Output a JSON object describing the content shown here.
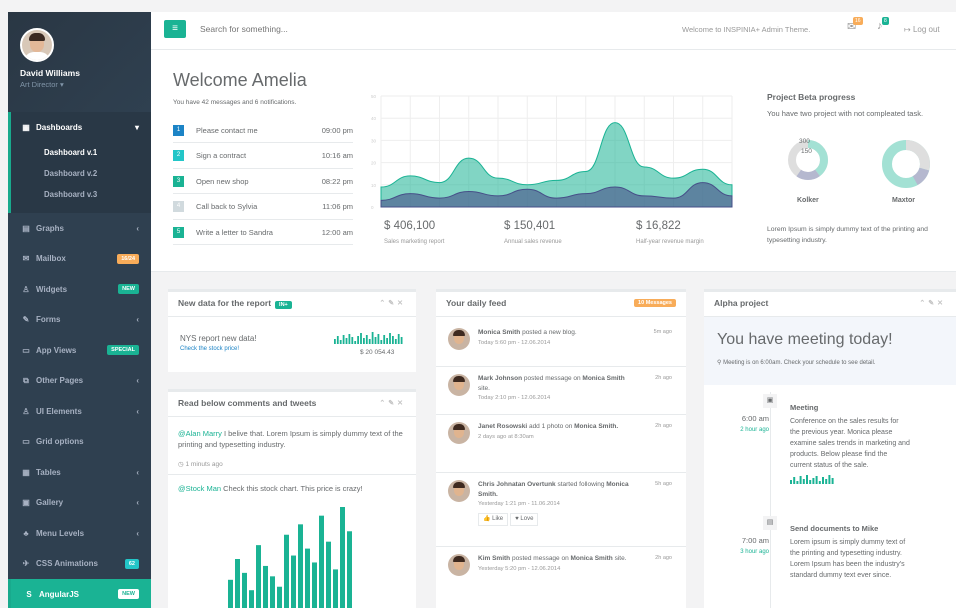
{
  "profile": {
    "name": "David Williams",
    "role": "Art Director ▾"
  },
  "nav": {
    "dashboards": "Dashboards",
    "sub": [
      "Dashboard v.1",
      "Dashboard v.2",
      "Dashboard v.3"
    ],
    "items": [
      {
        "label": "Graphs",
        "icon": "▤",
        "arrow": "‹"
      },
      {
        "label": "Mailbox",
        "icon": "✉",
        "badge": "16/24",
        "badge_color": "orange"
      },
      {
        "label": "Widgets",
        "icon": "♙",
        "badge": "NEW",
        "badge_color": "green"
      },
      {
        "label": "Forms",
        "icon": "✎",
        "arrow": "‹"
      },
      {
        "label": "App Views",
        "icon": "▭",
        "badge": "SPECIAL",
        "badge_color": "green"
      },
      {
        "label": "Other Pages",
        "icon": "⧉",
        "arrow": "‹"
      },
      {
        "label": "UI Elements",
        "icon": "♙",
        "arrow": "‹"
      },
      {
        "label": "Grid options",
        "icon": "▭"
      },
      {
        "label": "Tables",
        "icon": "▦",
        "arrow": "‹"
      },
      {
        "label": "Gallery",
        "icon": "▣",
        "arrow": "‹"
      },
      {
        "label": "Menu Levels",
        "icon": "♣",
        "arrow": "‹"
      },
      {
        "label": "CSS Animations",
        "icon": "✈",
        "badge": "62",
        "badge_color": "blue"
      }
    ],
    "last": {
      "label": "AngularJS",
      "icon": "S",
      "badge": "NEW"
    }
  },
  "topbar": {
    "menu_icon": "≡",
    "search_placeholder": "Search for something...",
    "welcome": "Welcome to INSPINIA+ Admin Theme.",
    "mail_count": "16",
    "bell_count": "8",
    "logout": "Log out"
  },
  "hero": {
    "title": "Welcome Amelia",
    "subtitle": "You have 42 messages and 6 notifications.",
    "todos": [
      {
        "n": "1",
        "text": "Please contact me",
        "time": "09:00 pm",
        "color": "#1c84c6"
      },
      {
        "n": "2",
        "text": "Sign a contract",
        "time": "10:16 am",
        "color": "#23c6c8"
      },
      {
        "n": "3",
        "text": "Open new shop",
        "time": "08:22 pm",
        "color": "#1ab394"
      },
      {
        "n": "4",
        "text": "Call back to Sylvia",
        "time": "11:06 pm",
        "color": "#d1dade"
      },
      {
        "n": "5",
        "text": "Write a letter to Sandra",
        "time": "12:00 am",
        "color": "#1ab394"
      }
    ],
    "stats": [
      {
        "value": "$ 406,100",
        "label": "Sales marketing report"
      },
      {
        "value": "$ 150,401",
        "label": "Annual sales revenue"
      },
      {
        "value": "$ 16,822",
        "label": "Half-year revenue margin"
      }
    ]
  },
  "chart_data": {
    "type": "area",
    "ylim": [
      0,
      50
    ],
    "ytick_labels": [
      "0",
      "10",
      "20",
      "30",
      "40",
      "50"
    ],
    "series": [
      {
        "color": "#1ab394",
        "values": [
          9,
          14,
          11,
          22,
          13,
          10,
          12,
          16,
          38,
          18,
          13,
          17,
          10
        ]
      },
      {
        "color": "#464f88",
        "values": [
          3,
          6,
          4,
          7,
          5,
          8,
          4,
          6,
          9,
          5,
          4,
          11,
          5
        ]
      }
    ]
  },
  "beta": {
    "title": "Project Beta progress",
    "desc": "You have two project with not compleated task.",
    "donut1": {
      "label": "Kolker",
      "vals": [
        "300",
        "150"
      ]
    },
    "donut2": {
      "label": "Maxtor"
    },
    "lorem": "Lorem Ipsum is simply dummy text of the printing and typesetting industry."
  },
  "report": {
    "title": "New data for the report",
    "badge": "IN+",
    "text": "NYS report new data!",
    "link": "Check the stock price!",
    "value": "$ 20 054.43"
  },
  "comments": {
    "title": "Read below comments and tweets",
    "c1_user": "@Alan Marry",
    "c1_text": "I belive that. Lorem Ipsum is simply dummy text of the printing and typesetting industry.",
    "c1_time": "1 minuts ago",
    "c2_user": "@Stock Man",
    "c2_text": "Check this stock chart. This price is crazy!"
  },
  "comments_bars": [
    18,
    30,
    22,
    12,
    38,
    26,
    20,
    14,
    44,
    32,
    50,
    36,
    28,
    55,
    40,
    24,
    60,
    46
  ],
  "feed": {
    "title": "Your daily feed",
    "badge": "10 Messages",
    "items": [
      {
        "name": "Monica Smith",
        "action": "posted a new blog.",
        "date": "Today 5:60 pm - 12.06.2014",
        "ago": "5m ago"
      },
      {
        "name": "Mark Johnson",
        "action": "posted message on",
        "target": "Monica Smith",
        "tail": "site.",
        "date": "Today 2:10 pm - 12.06.2014",
        "ago": "2h ago"
      },
      {
        "name": "Janet Rosowski",
        "action": "add 1 photo on",
        "target": "Monica Smith.",
        "date": "2 days ago at 8:30am",
        "ago": "2h ago"
      },
      {
        "name": "Chris Johnatan Overtunk",
        "action": "started following",
        "target": "Monica Smith.",
        "date": "Yesterday 1:21 pm - 11.06.2014",
        "ago": "5h ago",
        "like": "Like",
        "love": "Love"
      },
      {
        "name": "Kim Smith",
        "action": "posted message on",
        "target": "Monica Smith",
        "tail": "site.",
        "date": "Yesterday 5:20 pm - 12.06.2014",
        "ago": "2h ago"
      }
    ]
  },
  "alpha": {
    "title": "Alpha project",
    "meeting": "You have meeting today!",
    "meeting_sub": "Meeting is on 6:00am. Check your schedule to see detail.",
    "events": [
      {
        "time": "6:00 am",
        "ago": "2 hour ago",
        "icon": "▣",
        "title": "Meeting",
        "text": "Conference on the sales results for the previous year. Monica please examine sales trends in marketing and products. Below please find the current status of the sale."
      },
      {
        "time": "7:00 am",
        "ago": "3 hour ago",
        "icon": "▤",
        "title": "Send documents to Mike",
        "text": "Lorem ipsum is simply dummy text of the printing and typesetting industry. Lorem Ipsum has been the industry's standard dummy text ever since."
      }
    ]
  }
}
